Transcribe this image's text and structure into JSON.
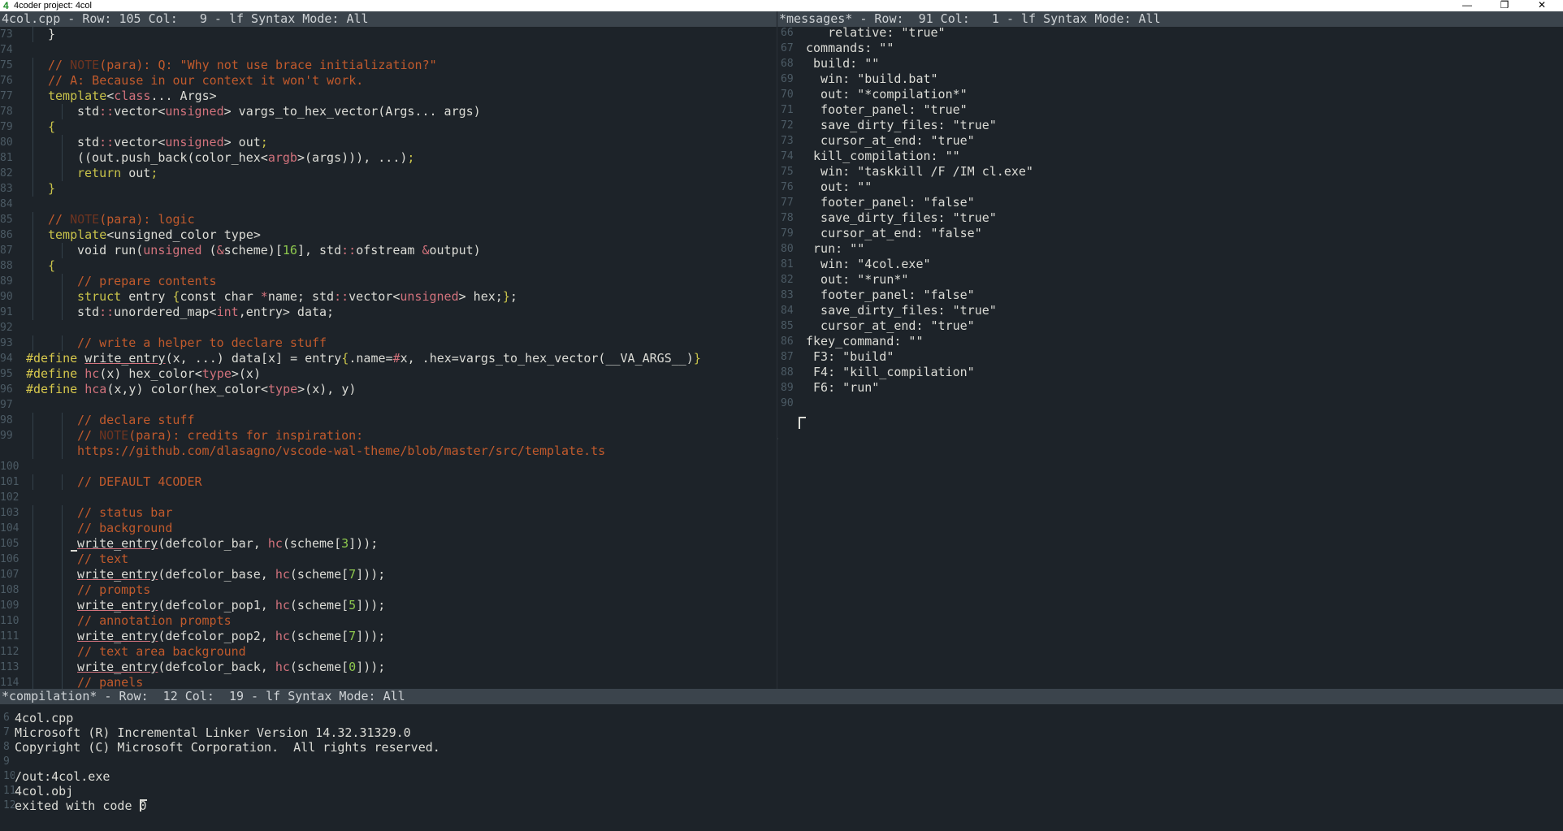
{
  "window": {
    "title": "4coder project: 4col",
    "app_icon": "4",
    "minimize": "—",
    "maximize": "❐",
    "close": "✕"
  },
  "left_panel": {
    "status": "4col.cpp - Row: 105 Col:   9 - lf Syntax Mode: All",
    "lines": [
      {
        "n": "73",
        "indent": 1,
        "t": [
          [
            "c-txt",
            "}"
          ]
        ]
      },
      {
        "n": "74",
        "indent": 0,
        "t": []
      },
      {
        "n": "75",
        "indent": 1,
        "t": [
          [
            "c-com",
            "// "
          ],
          [
            "c-note",
            "NOTE"
          ],
          [
            "c-com",
            "(para): Q: \"Why not use brace initialization?\""
          ]
        ]
      },
      {
        "n": "76",
        "indent": 1,
        "t": [
          [
            "c-com",
            "// A: Because in our context it won't work."
          ]
        ]
      },
      {
        "n": "77",
        "indent": 1,
        "t": [
          [
            "c-kw",
            "template"
          ],
          [
            "c-txt",
            "<"
          ],
          [
            "c-type",
            "class"
          ],
          [
            "c-txt",
            "... Args>"
          ]
        ]
      },
      {
        "n": "78",
        "indent": 2,
        "t": [
          [
            "c-txt",
            "std"
          ],
          [
            "c-type",
            "::"
          ],
          [
            "c-txt",
            "vector<"
          ],
          [
            "c-type",
            "unsigned"
          ],
          [
            "c-txt",
            "> vargs_to_hex_vector(Args... args)"
          ]
        ]
      },
      {
        "n": "79",
        "indent": 1,
        "t": [
          [
            "c-kw",
            "{"
          ]
        ]
      },
      {
        "n": "80",
        "indent": 2,
        "t": [
          [
            "c-txt",
            "std"
          ],
          [
            "c-type",
            "::"
          ],
          [
            "c-txt",
            "vector<"
          ],
          [
            "c-type",
            "unsigned"
          ],
          [
            "c-txt",
            "> out"
          ],
          [
            "c-kw",
            ";"
          ]
        ]
      },
      {
        "n": "81",
        "indent": 2,
        "t": [
          [
            "c-txt",
            "((out.push_back(color_hex<"
          ],
          [
            "c-type",
            "argb"
          ],
          [
            "c-txt",
            ">(args))), ...)"
          ],
          [
            "c-kw",
            ";"
          ]
        ]
      },
      {
        "n": "82",
        "indent": 2,
        "t": [
          [
            "c-kw",
            "return"
          ],
          [
            "c-txt",
            " out"
          ],
          [
            "c-kw",
            ";"
          ]
        ]
      },
      {
        "n": "83",
        "indent": 1,
        "t": [
          [
            "c-kw",
            "}"
          ]
        ]
      },
      {
        "n": "84",
        "indent": 0,
        "t": []
      },
      {
        "n": "85",
        "indent": 1,
        "t": [
          [
            "c-com",
            "// "
          ],
          [
            "c-note",
            "NOTE"
          ],
          [
            "c-com",
            "(para): logic"
          ]
        ]
      },
      {
        "n": "86",
        "indent": 1,
        "t": [
          [
            "c-kw",
            "template"
          ],
          [
            "c-txt",
            "<unsigned_color type>"
          ]
        ]
      },
      {
        "n": "87",
        "indent": 2,
        "t": [
          [
            "c-txt",
            "void run("
          ],
          [
            "c-type",
            "unsigned"
          ],
          [
            "c-txt",
            " ("
          ],
          [
            "c-type",
            "&"
          ],
          [
            "c-txt",
            "scheme)["
          ],
          [
            "c-num",
            "16"
          ],
          [
            "c-txt",
            "], std"
          ],
          [
            "c-type",
            "::"
          ],
          [
            "c-txt",
            "ofstream "
          ],
          [
            "c-type",
            "&"
          ],
          [
            "c-txt",
            "output)"
          ]
        ]
      },
      {
        "n": "88",
        "indent": 1,
        "t": [
          [
            "c-kw",
            "{"
          ]
        ]
      },
      {
        "n": "89",
        "indent": 2,
        "t": [
          [
            "c-com",
            "// prepare contents"
          ]
        ]
      },
      {
        "n": "90",
        "indent": 2,
        "t": [
          [
            "c-kw",
            "struct"
          ],
          [
            "c-txt",
            " entry "
          ],
          [
            "c-kw",
            "{"
          ],
          [
            "c-txt",
            "const char "
          ],
          [
            "c-type",
            "*"
          ],
          [
            "c-txt",
            "name; std"
          ],
          [
            "c-type",
            "::"
          ],
          [
            "c-txt",
            "vector<"
          ],
          [
            "c-type",
            "unsigned"
          ],
          [
            "c-txt",
            "> hex;"
          ],
          [
            "c-kw",
            "}"
          ],
          [
            "c-txt",
            ";"
          ]
        ]
      },
      {
        "n": "91",
        "indent": 2,
        "t": [
          [
            "c-txt",
            "std"
          ],
          [
            "c-type",
            "::"
          ],
          [
            "c-txt",
            "unordered_map<"
          ],
          [
            "c-type",
            "int"
          ],
          [
            "c-txt",
            ",entry> data;"
          ]
        ]
      },
      {
        "n": "92",
        "indent": 0,
        "t": []
      },
      {
        "n": "93",
        "indent": 2,
        "t": [
          [
            "c-com",
            "// write a helper to declare stuff"
          ]
        ]
      },
      {
        "n": "94",
        "indent": -1,
        "t": [
          [
            "c-pre",
            "#define "
          ],
          [
            "c-txt u",
            "write_entry"
          ],
          [
            "c-txt",
            "(x, ...) data[x] = entry"
          ],
          [
            "c-kw",
            "{"
          ],
          [
            "c-txt",
            ".name="
          ],
          [
            "c-type",
            "#"
          ],
          [
            "c-txt",
            "x, .hex=vargs_to_hex_vector(__VA_ARGS__)"
          ],
          [
            "c-kw",
            "}"
          ]
        ]
      },
      {
        "n": "95",
        "indent": -1,
        "t": [
          [
            "c-pre",
            "#define "
          ],
          [
            "c-type",
            "hc"
          ],
          [
            "c-txt",
            "(x) hex_color<"
          ],
          [
            "c-type",
            "type"
          ],
          [
            "c-txt",
            ">(x)"
          ]
        ]
      },
      {
        "n": "96",
        "indent": -1,
        "t": [
          [
            "c-pre",
            "#define "
          ],
          [
            "c-type",
            "hca"
          ],
          [
            "c-txt",
            "(x,y) color(hex_color<"
          ],
          [
            "c-type",
            "type"
          ],
          [
            "c-txt",
            ">(x), y)"
          ]
        ]
      },
      {
        "n": "97",
        "indent": 0,
        "t": []
      },
      {
        "n": "98",
        "indent": 2,
        "t": [
          [
            "c-com",
            "// declare stuff"
          ]
        ]
      },
      {
        "n": "99",
        "indent": 2,
        "t": [
          [
            "c-com",
            "// "
          ],
          [
            "c-note",
            "NOTE"
          ],
          [
            "c-com",
            "(para): credits for inspiration:"
          ]
        ]
      },
      {
        "n": "",
        "indent": 2,
        "t": [
          [
            "c-com",
            "https://github.com/dlasagno/vscode-wal-theme/blob/master/src/template.ts"
          ]
        ]
      },
      {
        "n": "100",
        "indent": 0,
        "t": []
      },
      {
        "n": "101",
        "indent": 2,
        "t": [
          [
            "c-com",
            "// DEFAULT 4CODER"
          ]
        ]
      },
      {
        "n": "102",
        "indent": 0,
        "t": []
      },
      {
        "n": "103",
        "indent": 2,
        "t": [
          [
            "c-com",
            "// status bar"
          ]
        ]
      },
      {
        "n": "104",
        "indent": 2,
        "t": [
          [
            "c-com",
            "// background"
          ]
        ]
      },
      {
        "n": "105",
        "indent": 2,
        "cursor": true,
        "t": [
          [
            "c-txt u",
            "write_entry"
          ],
          [
            "c-txt",
            "(defcolor_bar, "
          ],
          [
            "c-type",
            "hc"
          ],
          [
            "c-txt",
            "(scheme["
          ],
          [
            "c-num",
            "3"
          ],
          [
            "c-txt",
            "]));"
          ]
        ]
      },
      {
        "n": "106",
        "indent": 2,
        "t": [
          [
            "c-com",
            "// text"
          ]
        ]
      },
      {
        "n": "107",
        "indent": 2,
        "t": [
          [
            "c-txt u",
            "write_entry"
          ],
          [
            "c-txt",
            "(defcolor_base, "
          ],
          [
            "c-type",
            "hc"
          ],
          [
            "c-txt",
            "(scheme["
          ],
          [
            "c-num",
            "7"
          ],
          [
            "c-txt",
            "]));"
          ]
        ]
      },
      {
        "n": "108",
        "indent": 2,
        "t": [
          [
            "c-com",
            "// prompts"
          ]
        ]
      },
      {
        "n": "109",
        "indent": 2,
        "t": [
          [
            "c-txt u",
            "write_entry"
          ],
          [
            "c-txt",
            "(defcolor_pop1, "
          ],
          [
            "c-type",
            "hc"
          ],
          [
            "c-txt",
            "(scheme["
          ],
          [
            "c-num",
            "5"
          ],
          [
            "c-txt",
            "]));"
          ]
        ]
      },
      {
        "n": "110",
        "indent": 2,
        "t": [
          [
            "c-com",
            "// annotation prompts"
          ]
        ]
      },
      {
        "n": "111",
        "indent": 2,
        "t": [
          [
            "c-txt u",
            "write_entry"
          ],
          [
            "c-txt",
            "(defcolor_pop2, "
          ],
          [
            "c-type",
            "hc"
          ],
          [
            "c-txt",
            "(scheme["
          ],
          [
            "c-num",
            "7"
          ],
          [
            "c-txt",
            "]));"
          ]
        ]
      },
      {
        "n": "112",
        "indent": 2,
        "t": [
          [
            "c-com",
            "// text area background"
          ]
        ]
      },
      {
        "n": "113",
        "indent": 2,
        "t": [
          [
            "c-txt u",
            "write_entry"
          ],
          [
            "c-txt",
            "(defcolor_back, "
          ],
          [
            "c-type",
            "hc"
          ],
          [
            "c-txt",
            "(scheme["
          ],
          [
            "c-num",
            "0"
          ],
          [
            "c-txt",
            "]));"
          ]
        ]
      },
      {
        "n": "114",
        "indent": 2,
        "t": [
          [
            "c-com",
            "// panels"
          ]
        ]
      }
    ]
  },
  "right_panel": {
    "status": "*messages* - Row:  91 Col:   1 - lf Syntax Mode: All",
    "lines": [
      {
        "n": "66",
        "t": "   relative: \"true\""
      },
      {
        "n": "67",
        "t": "commands: \"\""
      },
      {
        "n": "68",
        "t": " build: \"\""
      },
      {
        "n": "69",
        "t": "  win: \"build.bat\""
      },
      {
        "n": "70",
        "t": "  out: \"*compilation*\""
      },
      {
        "n": "71",
        "t": "  footer_panel: \"true\""
      },
      {
        "n": "72",
        "t": "  save_dirty_files: \"true\""
      },
      {
        "n": "73",
        "t": "  cursor_at_end: \"true\""
      },
      {
        "n": "74",
        "t": " kill_compilation: \"\""
      },
      {
        "n": "75",
        "t": "  win: \"taskkill /F /IM cl.exe\""
      },
      {
        "n": "76",
        "t": "  out: \"\""
      },
      {
        "n": "77",
        "t": "  footer_panel: \"false\""
      },
      {
        "n": "78",
        "t": "  save_dirty_files: \"true\""
      },
      {
        "n": "79",
        "t": "  cursor_at_end: \"false\""
      },
      {
        "n": "80",
        "t": " run: \"\""
      },
      {
        "n": "81",
        "t": "  win: \"4col.exe\""
      },
      {
        "n": "82",
        "t": "  out: \"*run*\""
      },
      {
        "n": "83",
        "t": "  footer_panel: \"false\""
      },
      {
        "n": "84",
        "t": "  save_dirty_files: \"true\""
      },
      {
        "n": "85",
        "t": "  cursor_at_end: \"true\""
      },
      {
        "n": "86",
        "t": "fkey_command: \"\""
      },
      {
        "n": "87",
        "t": " F3: \"build\""
      },
      {
        "n": "88",
        "t": " F4: \"kill_compilation\""
      },
      {
        "n": "89",
        "t": " F6: \"run\""
      },
      {
        "n": "90",
        "t": ""
      }
    ],
    "stray_mark": "\\"
  },
  "bottom_panel": {
    "status": "*compilation* - Row:  12 Col:  19 - lf Syntax Mode: All",
    "lines": [
      {
        "n": "6",
        "t": "4col.cpp"
      },
      {
        "n": "7",
        "t": "Microsoft (R) Incremental Linker Version 14.32.31329.0"
      },
      {
        "n": "8",
        "t": "Copyright (C) Microsoft Corporation.  All rights reserved."
      },
      {
        "n": "9",
        "t": ""
      },
      {
        "n": "10",
        "t": "/out:4col.exe"
      },
      {
        "n": "11",
        "t": "4col.obj"
      },
      {
        "n": "12",
        "t": "exited with code 0"
      }
    ]
  }
}
